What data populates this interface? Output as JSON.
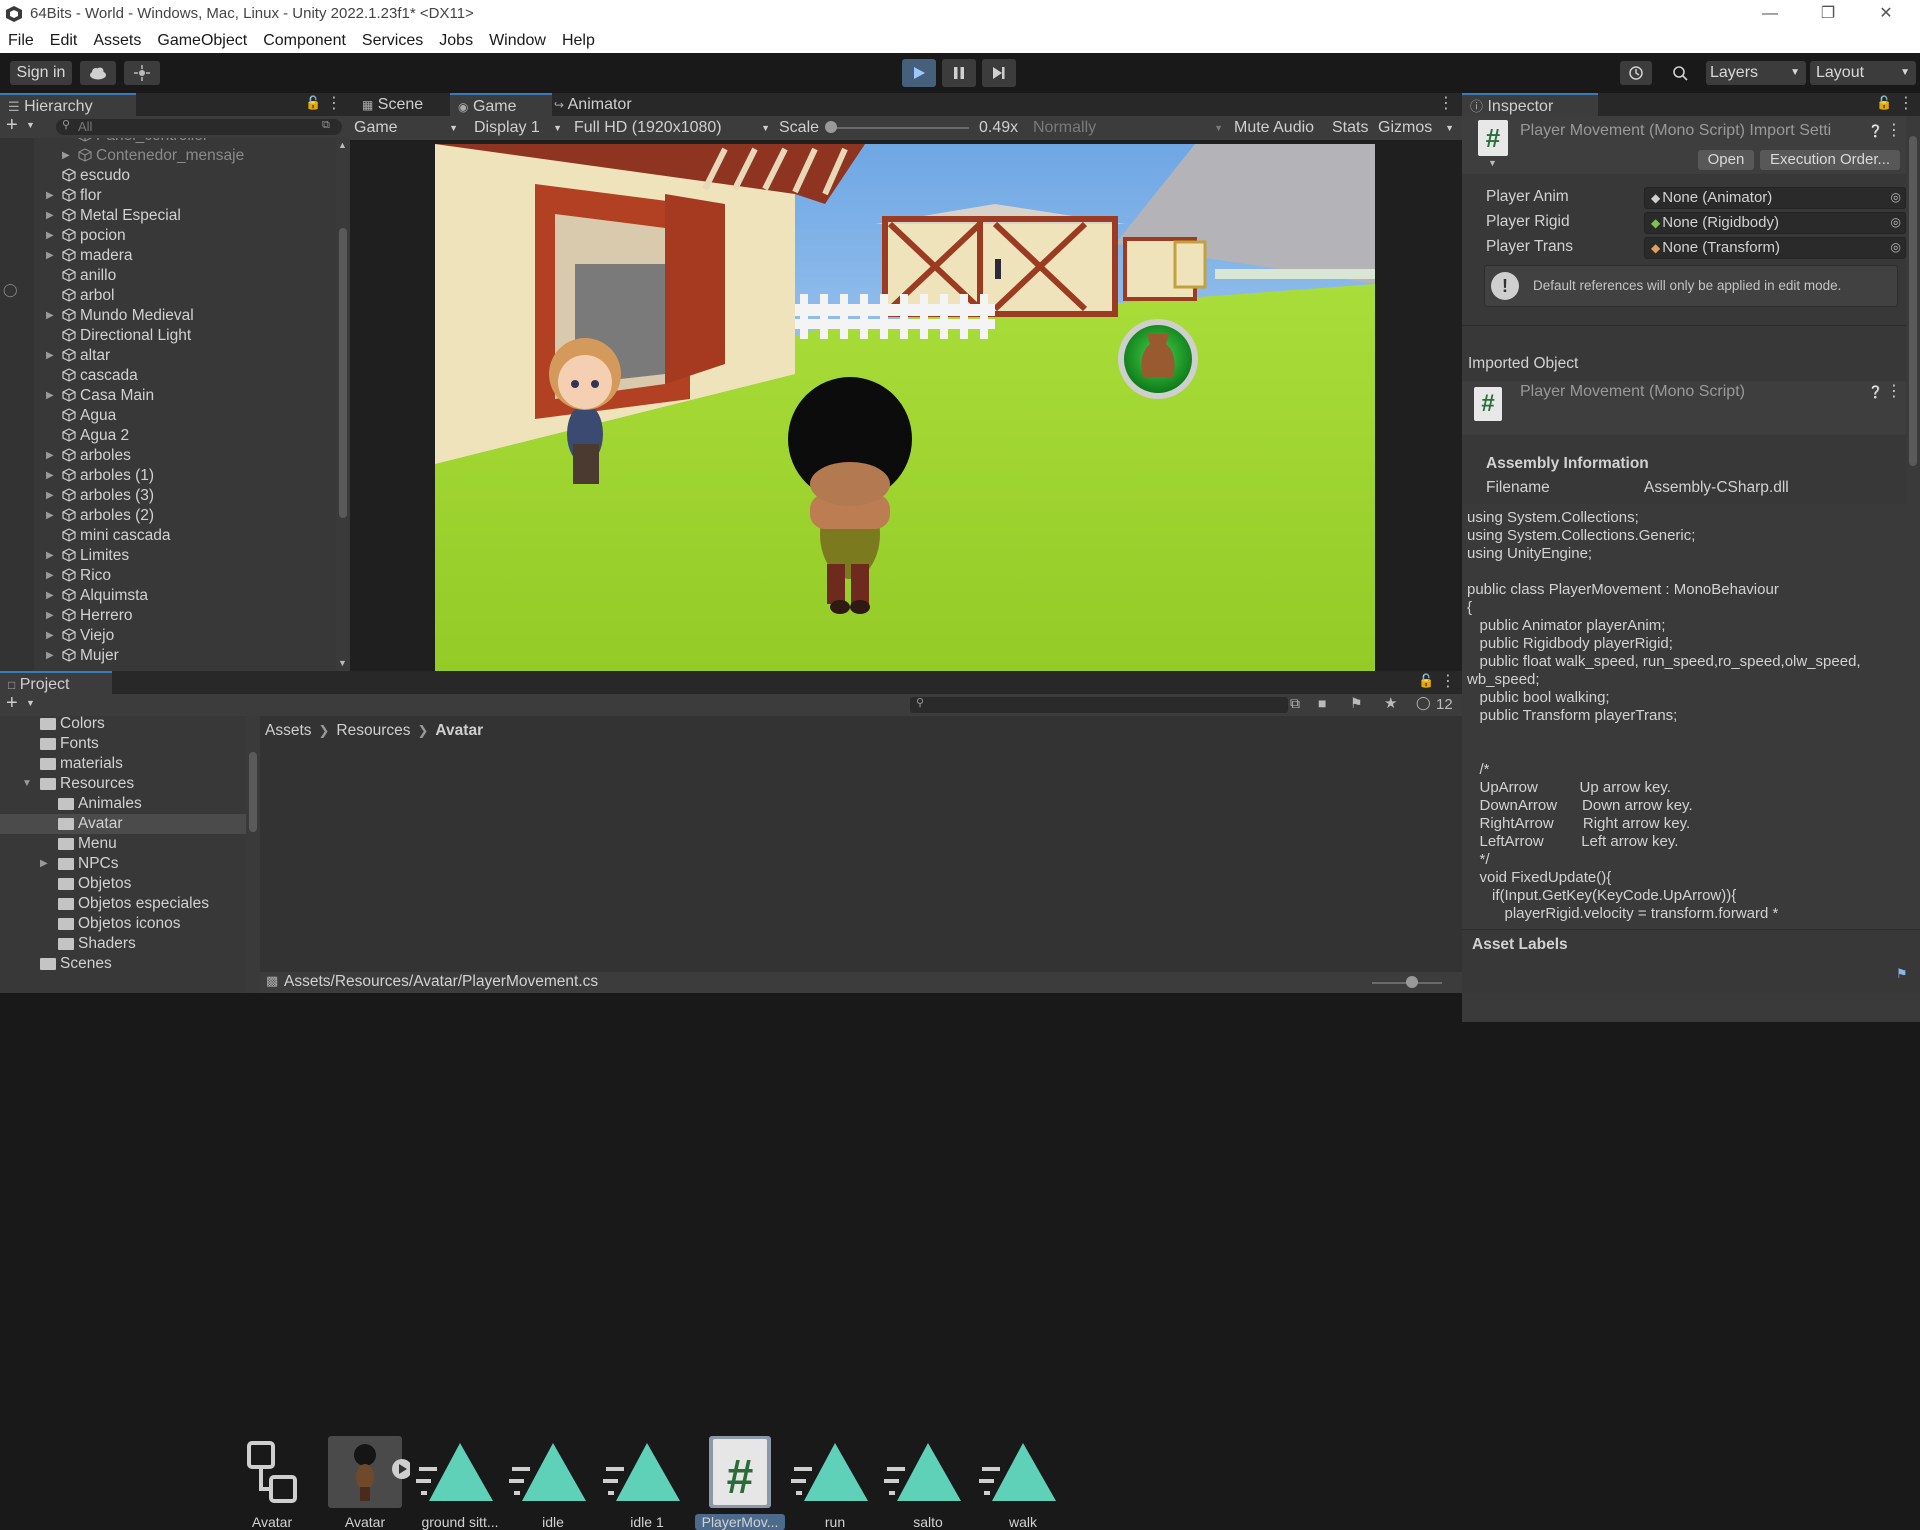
{
  "window": {
    "title": "64Bits - World - Windows, Mac, Linux - Unity 2022.1.23f1* <DX11>"
  },
  "menu": [
    "File",
    "Edit",
    "Assets",
    "GameObject",
    "Component",
    "Services",
    "Jobs",
    "Window",
    "Help"
  ],
  "toolbar": {
    "sign_in": "Sign in",
    "layers": "Layers",
    "layout": "Layout"
  },
  "hierarchy": {
    "title": "Hierarchy",
    "search_placeholder": "All",
    "items": [
      {
        "label": "Panel_controller",
        "faded": true,
        "arrow": false
      },
      {
        "label": "Contenedor_mensaje",
        "faded": true,
        "arrow": true
      },
      {
        "label": "escudo",
        "arrow": false
      },
      {
        "label": "flor",
        "arrow": true
      },
      {
        "label": "Metal Especial",
        "arrow": true
      },
      {
        "label": "pocion",
        "arrow": true
      },
      {
        "label": "madera",
        "arrow": true
      },
      {
        "label": "anillo",
        "arrow": false
      },
      {
        "label": "arbol",
        "arrow": false
      },
      {
        "label": "Mundo Medieval",
        "arrow": true
      },
      {
        "label": "Directional Light",
        "arrow": false
      },
      {
        "label": "altar",
        "arrow": true
      },
      {
        "label": "cascada",
        "arrow": false
      },
      {
        "label": "Casa Main",
        "arrow": true
      },
      {
        "label": "Agua",
        "arrow": false
      },
      {
        "label": "Agua 2",
        "arrow": false
      },
      {
        "label": "arboles",
        "arrow": true
      },
      {
        "label": "arboles (1)",
        "arrow": true
      },
      {
        "label": "arboles (3)",
        "arrow": true
      },
      {
        "label": "arboles (2)",
        "arrow": true
      },
      {
        "label": "mini cascada",
        "arrow": false
      },
      {
        "label": "Limites",
        "arrow": true
      },
      {
        "label": "Rico",
        "arrow": true
      },
      {
        "label": "Alquimsta",
        "arrow": true
      },
      {
        "label": "Herrero",
        "arrow": true
      },
      {
        "label": "Viejo",
        "arrow": true
      },
      {
        "label": "Mujer",
        "arrow": true
      }
    ]
  },
  "game": {
    "tabs": [
      "Scene",
      "Game",
      "Animator"
    ],
    "mode": "Game",
    "display": "Display 1",
    "resolution": "Full HD (1920x1080)",
    "scale_label": "Scale",
    "scale_value": "0.49x",
    "scale_fraction": 0.0,
    "vsync": "Normally",
    "mute": "Mute Audio",
    "stats": "Stats",
    "gizmos": "Gizmos"
  },
  "inspector": {
    "title": "Inspector",
    "header_title": "Player Movement (Mono Script) Import Setti",
    "open": "Open",
    "execution_order": "Execution Order...",
    "fields": [
      {
        "label": "Player Anim",
        "value": "None (Animator)"
      },
      {
        "label": "Player Rigid",
        "value": "None (Rigidbody)"
      },
      {
        "label": "Player Trans",
        "value": "None (Transform)"
      }
    ],
    "help": "Default references will only be applied in edit mode.",
    "imported_object": "Imported Object",
    "imported_title": "Player Movement (Mono Script)",
    "assembly_info": "Assembly Information",
    "filename_label": "Filename",
    "filename_value": "Assembly-CSharp.dll",
    "code": "using System.Collections;\nusing System.Collections.Generic;\nusing UnityEngine;\n\npublic class PlayerMovement : MonoBehaviour\n{\n   public Animator playerAnim;\n   public Rigidbody playerRigid;\n   public float walk_speed, run_speed,ro_speed,olw_speed,\nwb_speed;\n   public bool walking;\n   public Transform playerTrans;\n\n\n   /*\n   UpArrow          Up arrow key.\n   DownArrow      Down arrow key.\n   RightArrow       Right arrow key.\n   LeftArrow         Left arrow key.\n   */\n   void FixedUpdate(){\n      if(Input.GetKey(KeyCode.UpArrow)){\n         playerRigid.velocity = transform.forward *",
    "asset_labels": "Asset Labels"
  },
  "project": {
    "title": "Project",
    "hidden_count": "12",
    "breadcrumb": [
      "Assets",
      "Resources",
      "Avatar"
    ],
    "tree": [
      {
        "label": "Colors",
        "indent": 1,
        "arrow": false
      },
      {
        "label": "Fonts",
        "indent": 1,
        "arrow": false
      },
      {
        "label": "materials",
        "indent": 1,
        "arrow": false
      },
      {
        "label": "Resources",
        "indent": 1,
        "arrow": true,
        "open": true
      },
      {
        "label": "Animales",
        "indent": 2,
        "arrow": false
      },
      {
        "label": "Avatar",
        "indent": 2,
        "arrow": false,
        "selected": true
      },
      {
        "label": "Menu",
        "indent": 2,
        "arrow": false
      },
      {
        "label": "NPCs",
        "indent": 2,
        "arrow": true
      },
      {
        "label": "Objetos",
        "indent": 2,
        "arrow": false
      },
      {
        "label": "Objetos especiales",
        "indent": 2,
        "arrow": false
      },
      {
        "label": "Objetos iconos",
        "indent": 2,
        "arrow": false
      },
      {
        "label": "Shaders",
        "indent": 2,
        "arrow": false
      },
      {
        "label": "Scenes",
        "indent": 1,
        "arrow": false
      }
    ],
    "assets": [
      {
        "label": "Avatar",
        "kind": "controller"
      },
      {
        "label": "Avatar",
        "kind": "prefab"
      },
      {
        "label": "ground sitt...",
        "kind": "anim"
      },
      {
        "label": "idle",
        "kind": "anim"
      },
      {
        "label": "idle 1",
        "kind": "anim"
      },
      {
        "label": "PlayerMov...",
        "kind": "script",
        "selected": true
      },
      {
        "label": "run",
        "kind": "anim"
      },
      {
        "label": "salto",
        "kind": "anim"
      },
      {
        "label": "walk",
        "kind": "anim"
      }
    ],
    "status_path": "Assets/Resources/Avatar/PlayerMovement.cs"
  }
}
